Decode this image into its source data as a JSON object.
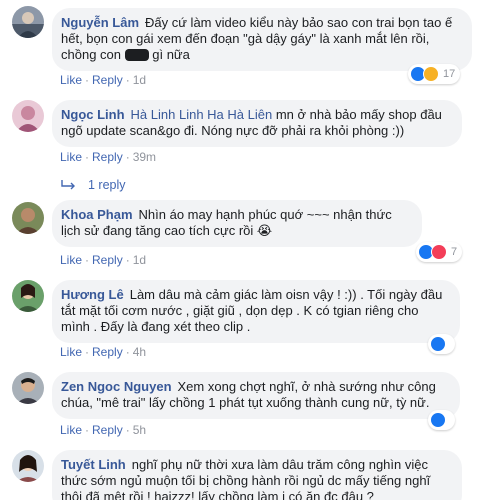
{
  "comments": [
    {
      "author": "Nguyễn Lâm",
      "text_part1": "Đấy cứ làm video kiểu này bảo sao con trai bọn tao ế hết, bọn con gái xem đến đoạn \"gà dậy gáy\" là xanh mắt lên rồi, chồng con",
      "text_part2": "gì nữa",
      "like": "Like",
      "reply": "Reply",
      "time": "1d",
      "reaction_count": "17",
      "reactions": [
        "like",
        "haha"
      ]
    },
    {
      "author": "Ngọc Linh",
      "tags": "Hà Linh Linh Ha Hà Liên",
      "text": "mn ở nhà bảo mấy shop đầu ngõ update scan&go đi. Nóng nực đỡ phải ra khỏi phòng :))",
      "like": "Like",
      "reply": "Reply",
      "time": "39m",
      "replies_label": "1 reply"
    },
    {
      "author": "Khoa Phạm",
      "text": "Nhìn áo may hạnh phúc quớ ~~~ nhận thức lịch sử đang tăng cao tích cực rồi 😭",
      "like": "Like",
      "reply": "Reply",
      "time": "1d",
      "reaction_count": "7",
      "reactions": [
        "like",
        "love"
      ]
    },
    {
      "author": "Hương Lê",
      "text": "Làm dâu mà cảm giác làm oisn vậy ! :)) . Tối ngày đầu tắt mặt tối cơm nước , giặt giũ , dọn dẹp . K có tgian riêng cho mình . Đấy là đang xét theo clip .",
      "like": "Like",
      "reply": "Reply",
      "time": "4h",
      "reaction_count": "",
      "reactions": [
        "like"
      ]
    },
    {
      "author": "Zen Ngoc Nguyen",
      "text": "Xem xong chợt nghĩ, ở nhà sướng như công chúa, \"mê trai\" lấy chồng 1 phát tụt xuống thành cung nữ, tỳ nữ.",
      "like": "Like",
      "reply": "Reply",
      "time": "5h",
      "reaction_count": "",
      "reactions": [
        "like"
      ]
    },
    {
      "author": "Tuyết Linh",
      "text": "nghĩ phụ nữ thời xưa làm dâu trăm công nghìn việc thức sớm ngủ muộn tối bị chồng hành rồi ngủ dc mấy tiếng nghĩ thôi đã mệt rồi ! haizzz! lấy chồng làm j có ăn đc đâu ?",
      "like": "",
      "reply": "",
      "time": ""
    }
  ],
  "separator": "·",
  "colors": {
    "name": "#385898",
    "link": "#4267b2",
    "bubble": "#f2f3f5",
    "meta": "#90949c",
    "like": "#1877f2",
    "love": "#f33e58",
    "haha": "#f7b125"
  }
}
